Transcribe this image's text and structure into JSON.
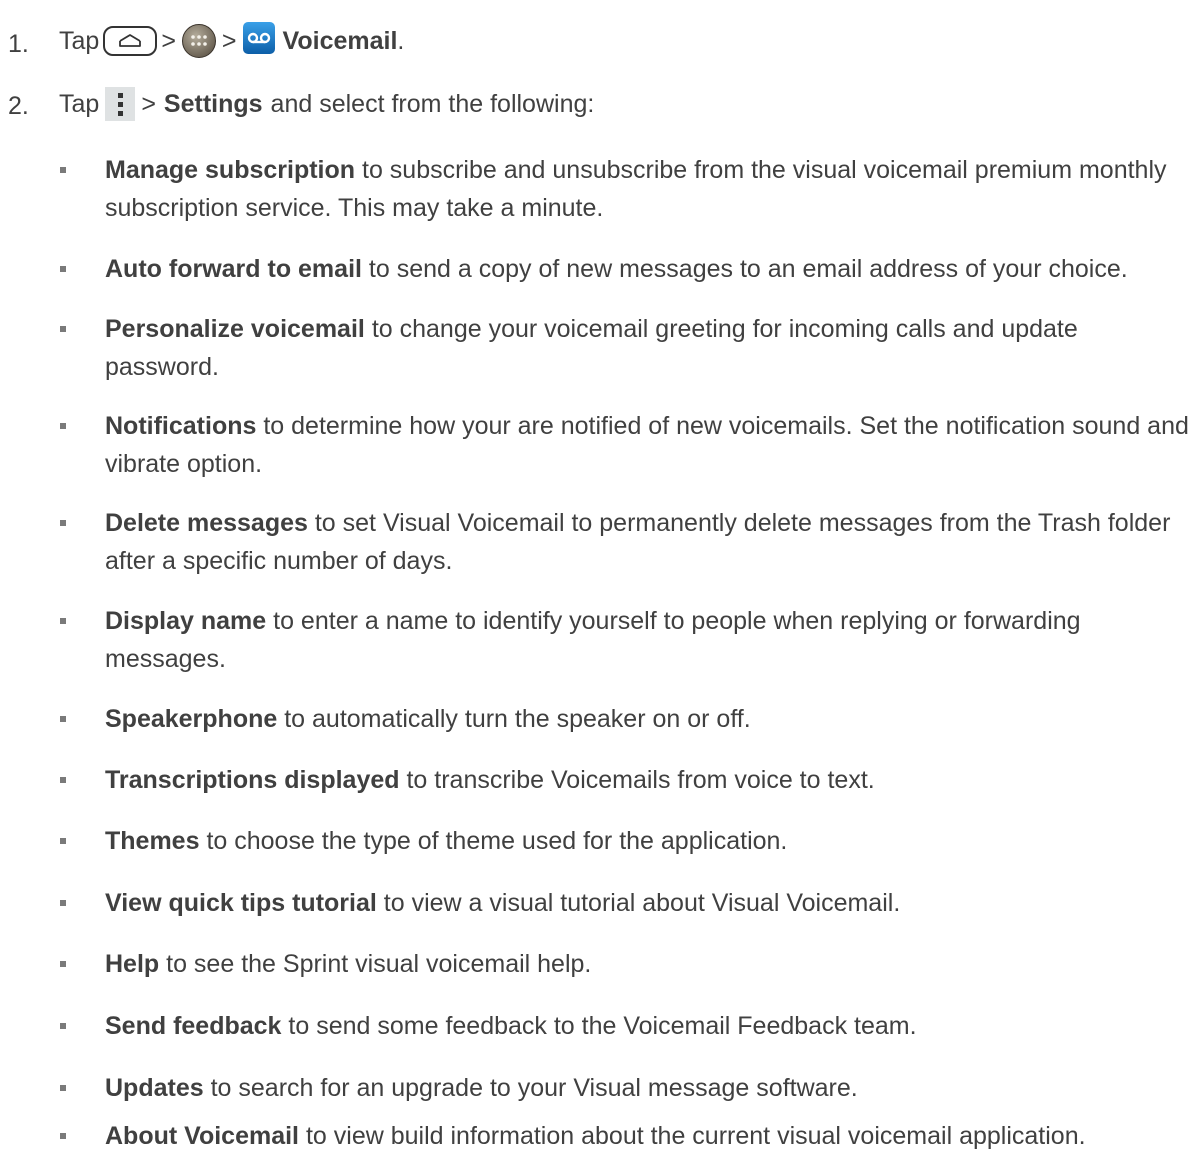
{
  "step1": {
    "number": "1.",
    "tap": "Tap",
    "sep1": ">",
    "sep2": ">",
    "app_name": "Voicemail",
    "period": "."
  },
  "step2": {
    "number": "2.",
    "tap": "Tap",
    "sep": ">",
    "settings": "Settings",
    "rest": "and select from the following:"
  },
  "icons": [
    "home-button-icon",
    "apps-icon",
    "voicemail-app-icon",
    "menu-icon"
  ],
  "options": [
    {
      "term": "Manage subscription",
      "desc": "to subscribe and unsubscribe from the visual voicemail premium monthly subscription service. This may take a minute."
    },
    {
      "term": "Auto forward to email",
      "desc": "to send a copy of new messages to an email address of your choice."
    },
    {
      "term": "Personalize voicemail",
      "desc": "to change your voicemail greeting for incoming calls and update password."
    },
    {
      "term": "Notifications",
      "desc": "to determine how your are notified of new voicemails. Set the notification sound and vibrate option."
    },
    {
      "term": "Delete messages",
      "desc": "to set Visual Voicemail to permanently delete messages from the Trash folder after a specific number of days."
    },
    {
      "term": "Display name",
      "desc": "to enter a name to identify yourself to people when replying or forwarding messages."
    },
    {
      "term": "Speakerphone",
      "desc": "to automatically turn the speaker on or off."
    },
    {
      "term": "Transcriptions displayed",
      "desc": "to transcribe Voicemails from voice to text."
    },
    {
      "term": "Themes",
      "desc": "to choose the type of theme used for the application."
    },
    {
      "term": "View quick tips tutorial",
      "desc": "to view a visual tutorial about Visual Voicemail."
    },
    {
      "term": "Help",
      "desc": "to see the Sprint visual voicemail help."
    },
    {
      "term": "Send feedback",
      "desc": "to send some feedback to the Voicemail Feedback team."
    },
    {
      "term": "Updates",
      "desc": "to search for an upgrade to your Visual message software."
    },
    {
      "term": "About Voicemail",
      "desc": "to view build information about the current visual voicemail application."
    }
  ]
}
